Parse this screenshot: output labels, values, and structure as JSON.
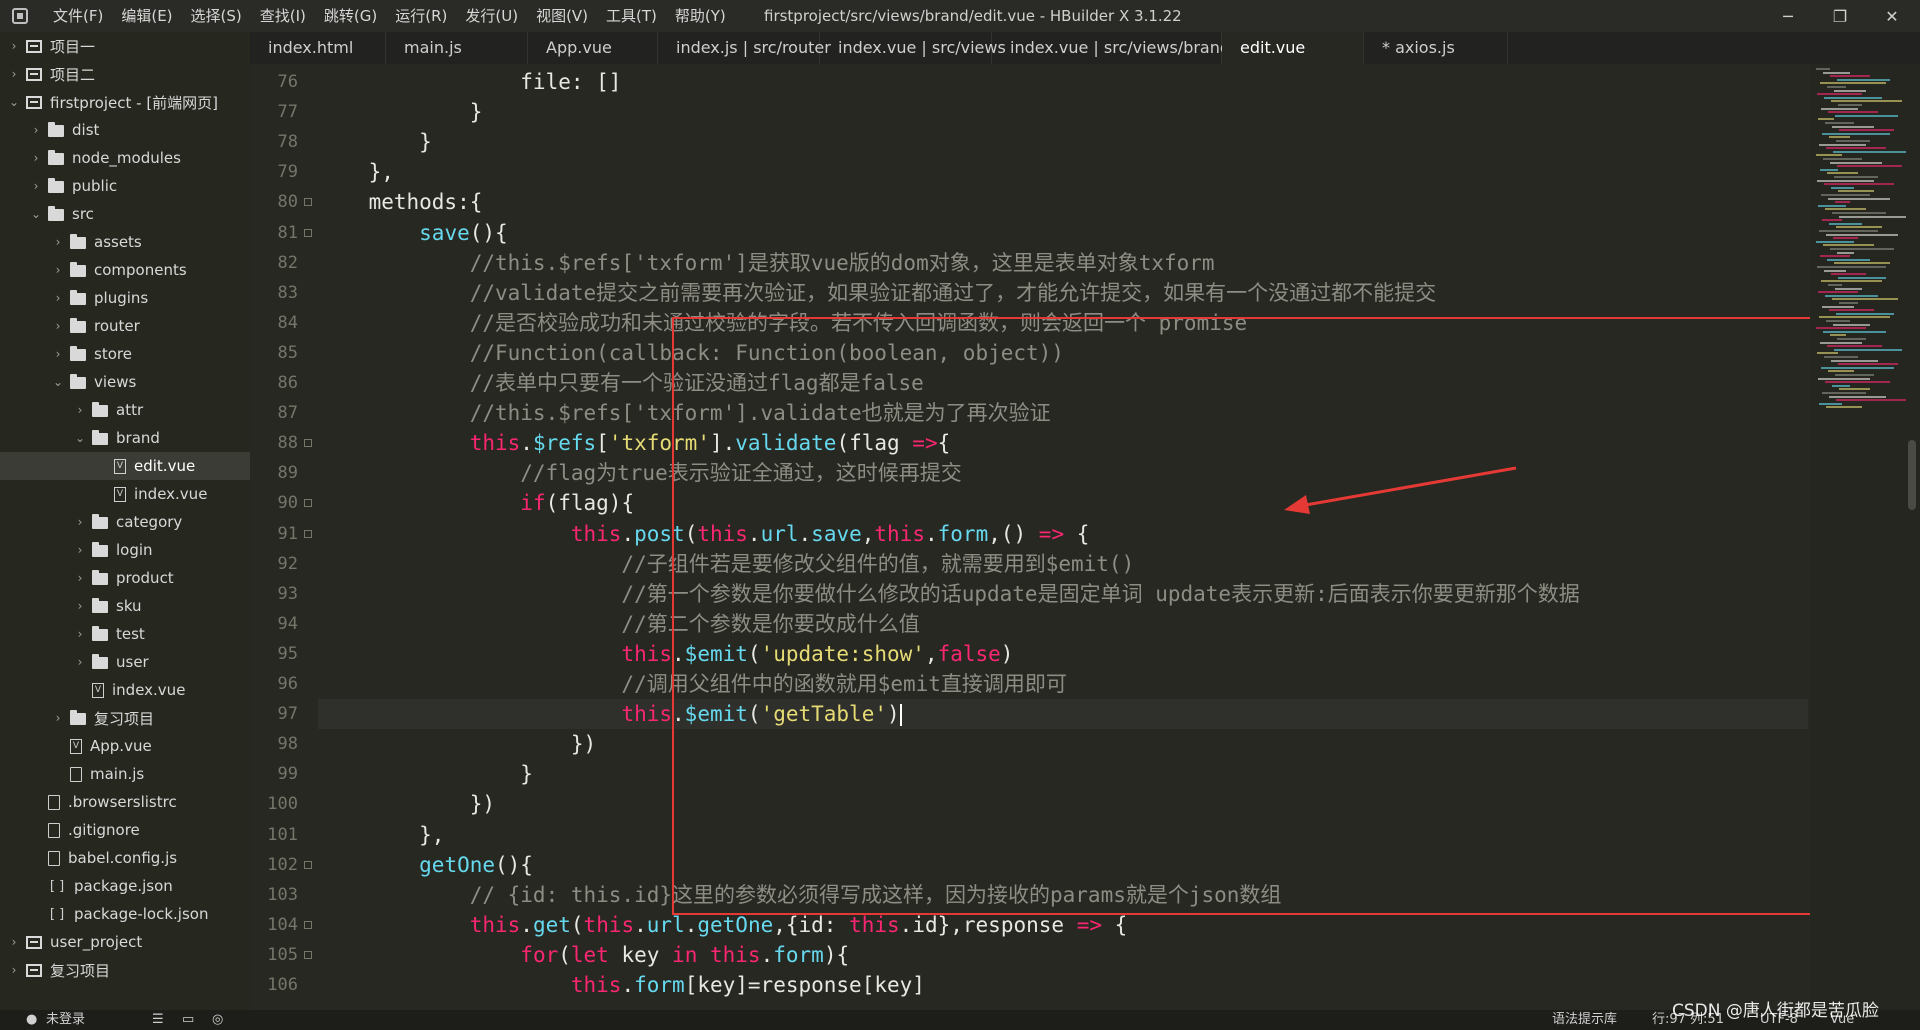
{
  "window": {
    "title": "firstproject/src/views/brand/edit.vue - HBuilder X 3.1.22",
    "controls": {
      "minimize": "─",
      "maximize": "❐",
      "close": "✕"
    }
  },
  "menu": [
    "文件(F)",
    "编辑(E)",
    "选择(S)",
    "查找(I)",
    "跳转(G)",
    "运行(R)",
    "发行(U)",
    "视图(V)",
    "工具(T)",
    "帮助(Y)"
  ],
  "sidebar": {
    "items": [
      {
        "label": "项目一",
        "icon": "project-icon",
        "depth": 0,
        "chev": "›"
      },
      {
        "label": "项目二",
        "icon": "project-icon",
        "depth": 0,
        "chev": "›"
      },
      {
        "label": "firstproject - [前端网页]",
        "icon": "project-icon",
        "depth": 0,
        "chev": "⌄"
      },
      {
        "label": "dist",
        "icon": "folder-icon",
        "depth": 1,
        "chev": "›"
      },
      {
        "label": "node_modules",
        "icon": "folder-icon",
        "depth": 1,
        "chev": "›"
      },
      {
        "label": "public",
        "icon": "folder-icon",
        "depth": 1,
        "chev": "›"
      },
      {
        "label": "src",
        "icon": "folder-icon",
        "depth": 1,
        "chev": "⌄"
      },
      {
        "label": "assets",
        "icon": "folder-icon",
        "depth": 2,
        "chev": "›"
      },
      {
        "label": "components",
        "icon": "folder-icon",
        "depth": 2,
        "chev": "›"
      },
      {
        "label": "plugins",
        "icon": "folder-icon",
        "depth": 2,
        "chev": "›"
      },
      {
        "label": "router",
        "icon": "folder-icon",
        "depth": 2,
        "chev": "›"
      },
      {
        "label": "store",
        "icon": "folder-icon",
        "depth": 2,
        "chev": "›"
      },
      {
        "label": "views",
        "icon": "folder-icon",
        "depth": 2,
        "chev": "⌄"
      },
      {
        "label": "attr",
        "icon": "folder-icon",
        "depth": 3,
        "chev": "›"
      },
      {
        "label": "brand",
        "icon": "folder-icon",
        "depth": 3,
        "chev": "⌄"
      },
      {
        "label": "edit.vue",
        "icon": "vue-file-icon",
        "depth": 4,
        "chev": "",
        "active": true
      },
      {
        "label": "index.vue",
        "icon": "vue-file-icon",
        "depth": 4,
        "chev": ""
      },
      {
        "label": "category",
        "icon": "folder-icon",
        "depth": 3,
        "chev": "›"
      },
      {
        "label": "login",
        "icon": "folder-icon",
        "depth": 3,
        "chev": "›"
      },
      {
        "label": "product",
        "icon": "folder-icon",
        "depth": 3,
        "chev": "›"
      },
      {
        "label": "sku",
        "icon": "folder-icon",
        "depth": 3,
        "chev": "›"
      },
      {
        "label": "test",
        "icon": "folder-icon",
        "depth": 3,
        "chev": "›"
      },
      {
        "label": "user",
        "icon": "folder-icon",
        "depth": 3,
        "chev": "›"
      },
      {
        "label": "index.vue",
        "icon": "vue-file-icon",
        "depth": 3,
        "chev": ""
      },
      {
        "label": "复习项目",
        "icon": "folder-icon",
        "depth": 2,
        "chev": "›"
      },
      {
        "label": "App.vue",
        "icon": "vue-file-icon",
        "depth": 2,
        "chev": ""
      },
      {
        "label": "main.js",
        "icon": "file-icon",
        "depth": 2,
        "chev": ""
      },
      {
        "label": ".browserslistrc",
        "icon": "file-icon",
        "depth": 1,
        "chev": ""
      },
      {
        "label": ".gitignore",
        "icon": "file-icon",
        "depth": 1,
        "chev": ""
      },
      {
        "label": "babel.config.js",
        "icon": "file-icon",
        "depth": 1,
        "chev": ""
      },
      {
        "label": "package.json",
        "icon": "json-file-icon",
        "depth": 1,
        "chev": ""
      },
      {
        "label": "package-lock.json",
        "icon": "json-file-icon",
        "depth": 1,
        "chev": ""
      },
      {
        "label": "user_project",
        "icon": "project-icon",
        "depth": 0,
        "chev": "›"
      },
      {
        "label": "复习项目",
        "icon": "project-icon",
        "depth": 0,
        "chev": "›"
      }
    ]
  },
  "tabs": [
    {
      "label": "index.html",
      "active": false
    },
    {
      "label": "main.js",
      "active": false
    },
    {
      "label": "App.vue",
      "active": false
    },
    {
      "label": "index.js | src/router",
      "active": false
    },
    {
      "label": "index.vue | src/views",
      "active": false
    },
    {
      "label": "index.vue | src/views/brand",
      "active": false
    },
    {
      "label": "edit.vue",
      "active": true
    },
    {
      "label": "* axios.js",
      "active": false
    }
  ],
  "editor": {
    "current_line": 97,
    "lines": [
      {
        "n": 76,
        "fold": false,
        "tokens": [
          [
            "p",
            "                file: []"
          ]
        ]
      },
      {
        "n": 77,
        "fold": false,
        "tokens": [
          [
            "p",
            "            }"
          ]
        ]
      },
      {
        "n": 78,
        "fold": false,
        "tokens": [
          [
            "p",
            "        }"
          ]
        ]
      },
      {
        "n": 79,
        "fold": false,
        "tokens": [
          [
            "p",
            "    },"
          ]
        ]
      },
      {
        "n": 80,
        "fold": true,
        "tokens": [
          [
            "p",
            "    methods:{"
          ]
        ]
      },
      {
        "n": 81,
        "fold": true,
        "tokens": [
          [
            "p",
            "        "
          ],
          [
            "f",
            "save"
          ],
          [
            "p",
            "(){"
          ]
        ]
      },
      {
        "n": 82,
        "fold": false,
        "tokens": [
          [
            "c",
            "            //this.$refs['txform']是获取vue版的dom对象，这里是表单对象txform"
          ]
        ]
      },
      {
        "n": 83,
        "fold": false,
        "tokens": [
          [
            "c",
            "            //validate提交之前需要再次验证，如果验证都通过了，才能允许提交，如果有一个没通过都不能提交"
          ]
        ]
      },
      {
        "n": 84,
        "fold": false,
        "tokens": [
          [
            "c",
            "            //是否校验成功和未通过校验的字段。若不传入回调函数，则会返回一个 promise"
          ]
        ]
      },
      {
        "n": 85,
        "fold": false,
        "tokens": [
          [
            "c",
            "            //Function(callback: Function(boolean, object))"
          ]
        ]
      },
      {
        "n": 86,
        "fold": false,
        "tokens": [
          [
            "c",
            "            //表单中只要有一个验证没通过flag都是false"
          ]
        ]
      },
      {
        "n": 87,
        "fold": false,
        "tokens": [
          [
            "c",
            "            //this.$refs['txform'].validate也就是为了再次验证"
          ]
        ]
      },
      {
        "n": 88,
        "fold": true,
        "tokens": [
          [
            "p",
            "            "
          ],
          [
            "k",
            "this"
          ],
          [
            "p",
            "."
          ],
          [
            "f",
            "$refs"
          ],
          [
            "p",
            "["
          ],
          [
            "s",
            "'txform'"
          ],
          [
            "p",
            "]."
          ],
          [
            "f",
            "validate"
          ],
          [
            "p",
            "(flag "
          ],
          [
            "k",
            "=>"
          ],
          [
            "p",
            "{"
          ]
        ]
      },
      {
        "n": 89,
        "fold": false,
        "tokens": [
          [
            "c",
            "                //flag为true表示验证全通过，这时候再提交"
          ]
        ]
      },
      {
        "n": 90,
        "fold": true,
        "tokens": [
          [
            "p",
            "                "
          ],
          [
            "k",
            "if"
          ],
          [
            "p",
            "(flag){"
          ]
        ]
      },
      {
        "n": 91,
        "fold": true,
        "tokens": [
          [
            "p",
            "                    "
          ],
          [
            "k",
            "this"
          ],
          [
            "p",
            "."
          ],
          [
            "f",
            "post"
          ],
          [
            "p",
            "("
          ],
          [
            "k",
            "this"
          ],
          [
            "p",
            "."
          ],
          [
            "f",
            "url"
          ],
          [
            "p",
            "."
          ],
          [
            "f",
            "save"
          ],
          [
            "p",
            ","
          ],
          [
            "k",
            "this"
          ],
          [
            "p",
            "."
          ],
          [
            "f",
            "form"
          ],
          [
            "p",
            ",() "
          ],
          [
            "k",
            "=>"
          ],
          [
            "p",
            " {"
          ]
        ]
      },
      {
        "n": 92,
        "fold": false,
        "tokens": [
          [
            "c",
            "                        //子组件若是要修改父组件的值，就需要用到$emit()"
          ]
        ]
      },
      {
        "n": 93,
        "fold": false,
        "tokens": [
          [
            "c",
            "                        //第一个参数是你要做什么修改的话update是固定单词 update表示更新:后面表示你要更新那个数据"
          ]
        ]
      },
      {
        "n": 94,
        "fold": false,
        "tokens": [
          [
            "c",
            "                        //第二个参数是你要改成什么值"
          ]
        ]
      },
      {
        "n": 95,
        "fold": false,
        "tokens": [
          [
            "p",
            "                        "
          ],
          [
            "k",
            "this"
          ],
          [
            "p",
            "."
          ],
          [
            "f",
            "$emit"
          ],
          [
            "p",
            "("
          ],
          [
            "s",
            "'update:show'"
          ],
          [
            "p",
            ","
          ],
          [
            "k",
            "false"
          ],
          [
            "p",
            ")"
          ]
        ]
      },
      {
        "n": 96,
        "fold": false,
        "tokens": [
          [
            "c",
            "                        //调用父组件中的函数就用$emit直接调用即可"
          ]
        ]
      },
      {
        "n": 97,
        "fold": false,
        "tokens": [
          [
            "p",
            "                        "
          ],
          [
            "k",
            "this"
          ],
          [
            "p",
            "."
          ],
          [
            "f",
            "$emit"
          ],
          [
            "p",
            "("
          ],
          [
            "s",
            "'getTable'"
          ],
          [
            "p",
            ")"
          ]
        ],
        "caret": true
      },
      {
        "n": 98,
        "fold": false,
        "tokens": [
          [
            "p",
            "                    })"
          ]
        ]
      },
      {
        "n": 99,
        "fold": false,
        "tokens": [
          [
            "p",
            "                }"
          ]
        ]
      },
      {
        "n": 100,
        "fold": false,
        "tokens": [
          [
            "p",
            "            })"
          ]
        ]
      },
      {
        "n": 101,
        "fold": false,
        "tokens": [
          [
            "p",
            "        },"
          ]
        ]
      },
      {
        "n": 102,
        "fold": true,
        "tokens": [
          [
            "p",
            "        "
          ],
          [
            "f",
            "getOne"
          ],
          [
            "p",
            "(){"
          ]
        ]
      },
      {
        "n": 103,
        "fold": false,
        "tokens": [
          [
            "c",
            "            // {id: this.id}这里的参数必须得写成这样，因为接收的params就是个json数组"
          ]
        ]
      },
      {
        "n": 104,
        "fold": true,
        "tokens": [
          [
            "p",
            "            "
          ],
          [
            "k",
            "this"
          ],
          [
            "p",
            "."
          ],
          [
            "f",
            "get"
          ],
          [
            "p",
            "("
          ],
          [
            "k",
            "this"
          ],
          [
            "p",
            "."
          ],
          [
            "f",
            "url"
          ],
          [
            "p",
            "."
          ],
          [
            "f",
            "getOne"
          ],
          [
            "p",
            ",{id: "
          ],
          [
            "k",
            "this"
          ],
          [
            "p",
            ".id},response "
          ],
          [
            "k",
            "=>"
          ],
          [
            "p",
            " {"
          ]
        ]
      },
      {
        "n": 105,
        "fold": true,
        "tokens": [
          [
            "p",
            "                "
          ],
          [
            "k",
            "for"
          ],
          [
            "p",
            "("
          ],
          [
            "k",
            "let"
          ],
          [
            "p",
            " key "
          ],
          [
            "k",
            "in"
          ],
          [
            "p",
            " "
          ],
          [
            "k",
            "this"
          ],
          [
            "p",
            "."
          ],
          [
            "f",
            "form"
          ],
          [
            "p",
            "){"
          ]
        ]
      },
      {
        "n": 106,
        "fold": false,
        "tokens": [
          [
            "p",
            "                    "
          ],
          [
            "k",
            "this"
          ],
          [
            "p",
            "."
          ],
          [
            "f",
            "form"
          ],
          [
            "p",
            "[key]=response[key]"
          ]
        ]
      }
    ]
  },
  "statusbar": {
    "login": "未登录",
    "syntax_lib": "语法提示库",
    "position": "行:97  列:51",
    "encoding": "UTF-8",
    "lang": "Vue"
  },
  "watermark": "CSDN @唐人街都是苦瓜脸",
  "colors": {
    "keyword": "#f92672",
    "function": "#66d9ef",
    "string": "#e6db74",
    "comment": "#8d8d84",
    "highlight_box": "#e53935"
  }
}
